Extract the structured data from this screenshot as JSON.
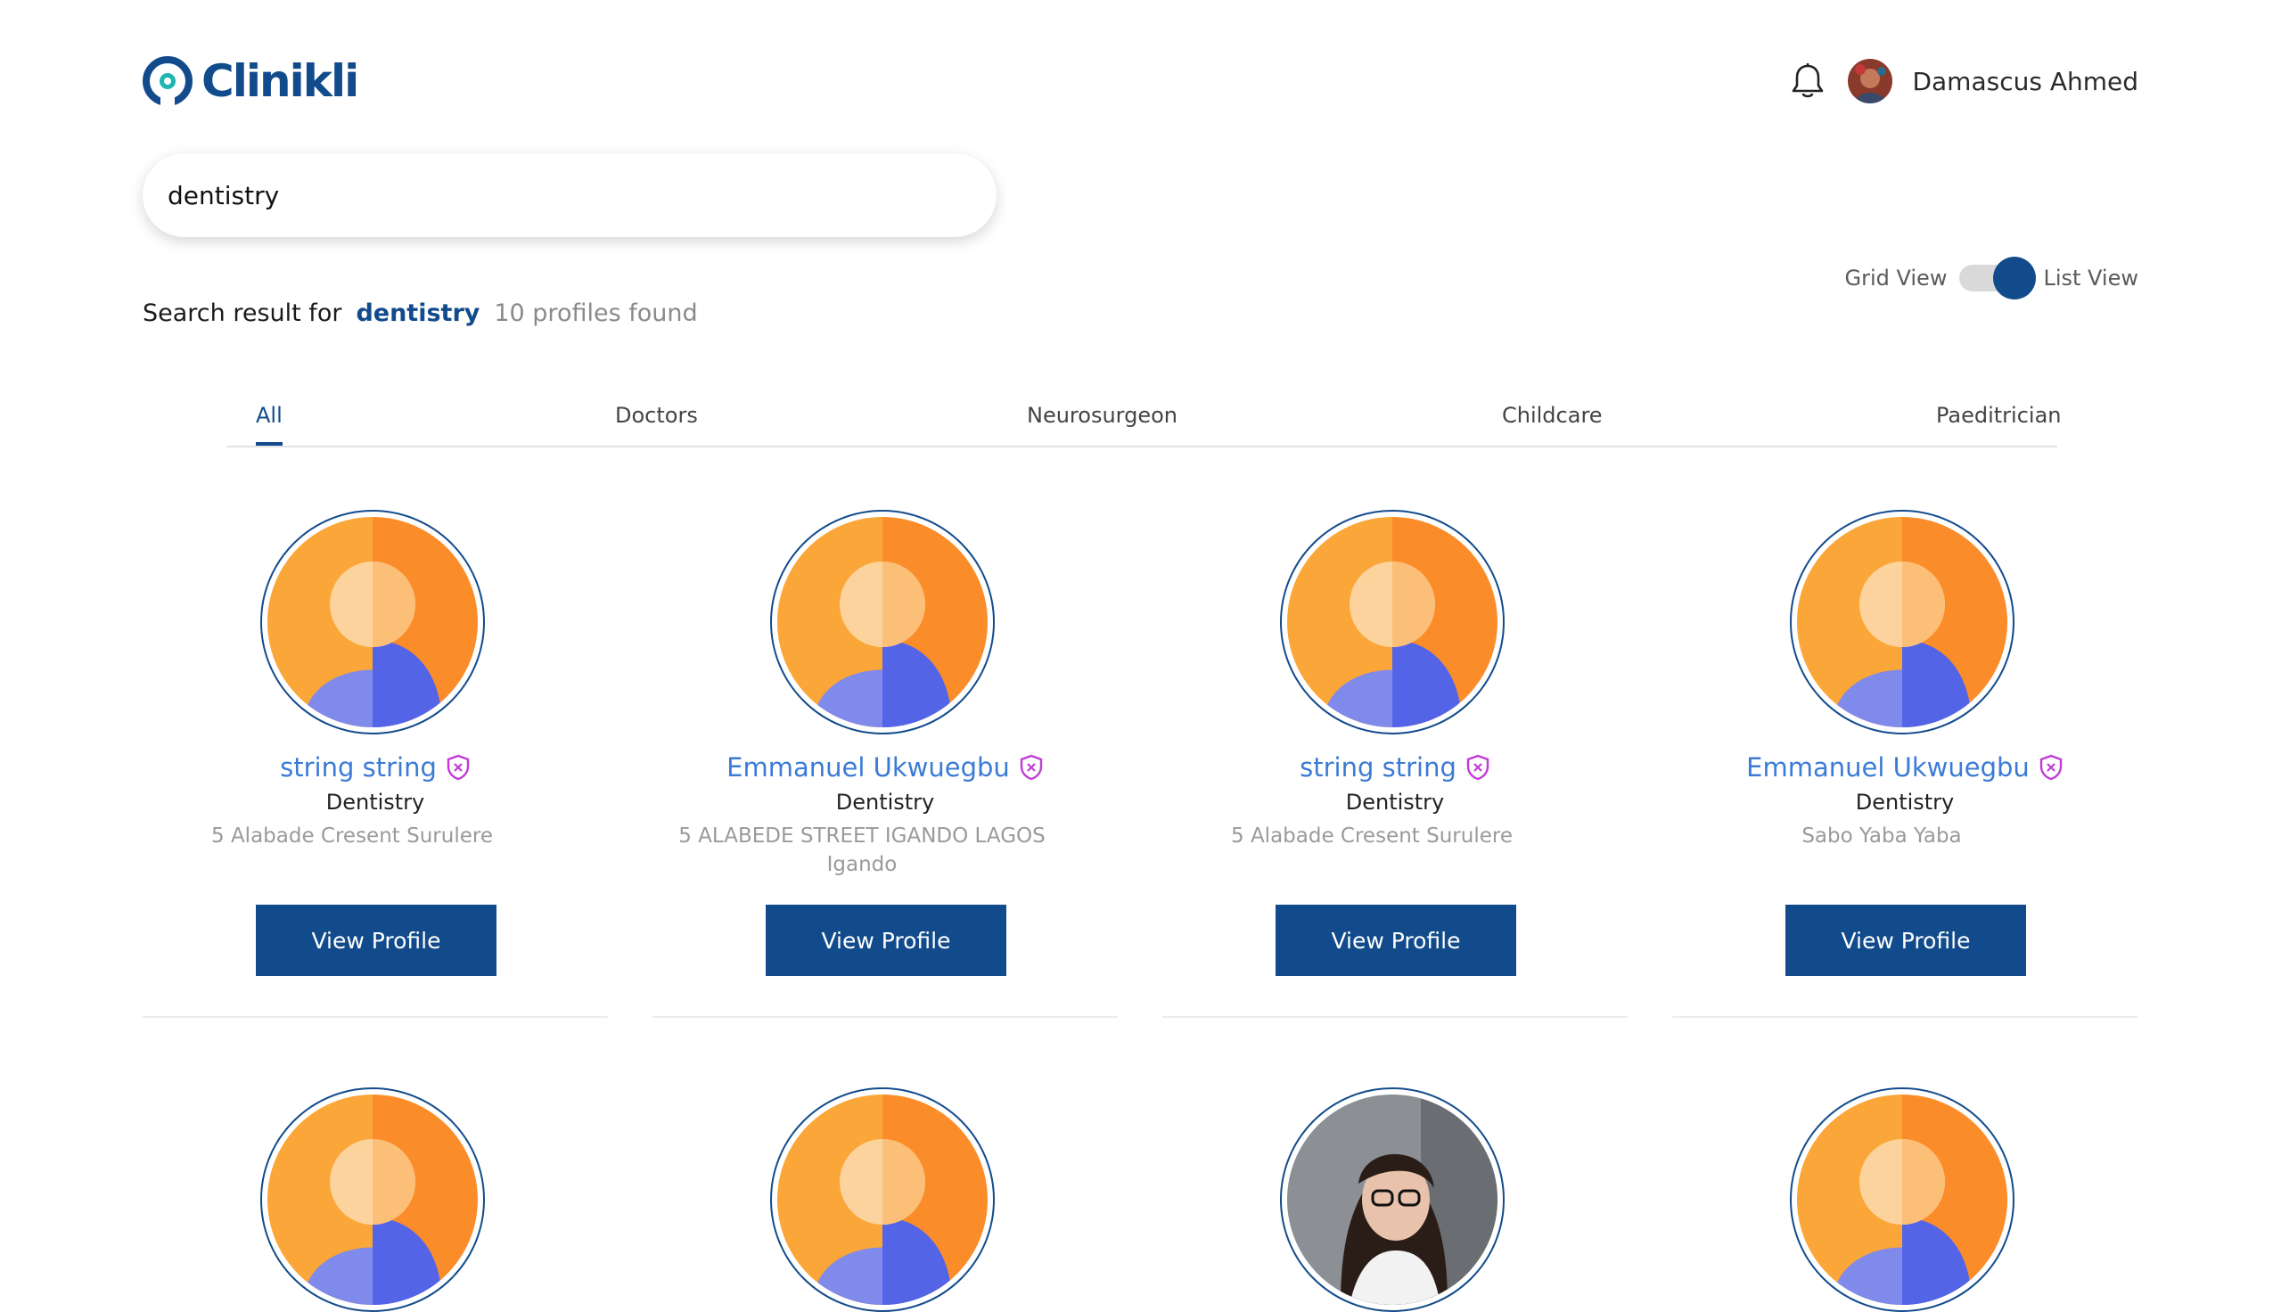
{
  "app": {
    "name": "Clinikli"
  },
  "header": {
    "user_name": "Damascus Ahmed",
    "notification_icon": "bell-icon"
  },
  "search": {
    "value": "dentistry",
    "placeholder": ""
  },
  "results": {
    "prefix": "Search result for",
    "term": "dentistry",
    "count_text": "10 profiles found"
  },
  "view_toggle": {
    "grid_label": "Grid View",
    "list_label": "List View",
    "selected": "List View"
  },
  "tabs": [
    {
      "label": "All",
      "active": true
    },
    {
      "label": "Doctors",
      "active": false
    },
    {
      "label": "Neurosurgeon",
      "active": false
    },
    {
      "label": "Childcare",
      "active": false
    },
    {
      "label": "Paeditrician",
      "active": false
    }
  ],
  "profiles": [
    {
      "name": "string string",
      "specialty": "Dentistry",
      "address": "5 Alabade Cresent Surulere",
      "button": "View Profile",
      "avatar": "placeholder-avatar"
    },
    {
      "name": "Emmanuel Ukwuegbu",
      "specialty": "Dentistry",
      "address": "5 ALABEDE STREET IGANDO LAGOS Igando",
      "button": "View Profile",
      "avatar": "placeholder-avatar"
    },
    {
      "name": "string string",
      "specialty": "Dentistry",
      "address": "5 Alabade Cresent Surulere",
      "button": "View Profile",
      "avatar": "placeholder-avatar"
    },
    {
      "name": "Emmanuel Ukwuegbu",
      "specialty": "Dentistry",
      "address": "Sabo Yaba Yaba",
      "button": "View Profile",
      "avatar": "placeholder-avatar"
    },
    {
      "avatar": "placeholder-avatar"
    },
    {
      "avatar": "placeholder-avatar"
    },
    {
      "avatar": "photo-avatar"
    },
    {
      "avatar": "placeholder-avatar"
    }
  ],
  "colors": {
    "brand": "#124b8c",
    "name_link": "#3b7bd6",
    "badge": "#c13bd6",
    "avatar_orange": "#fb8c2a",
    "avatar_blue": "#5464e6"
  }
}
